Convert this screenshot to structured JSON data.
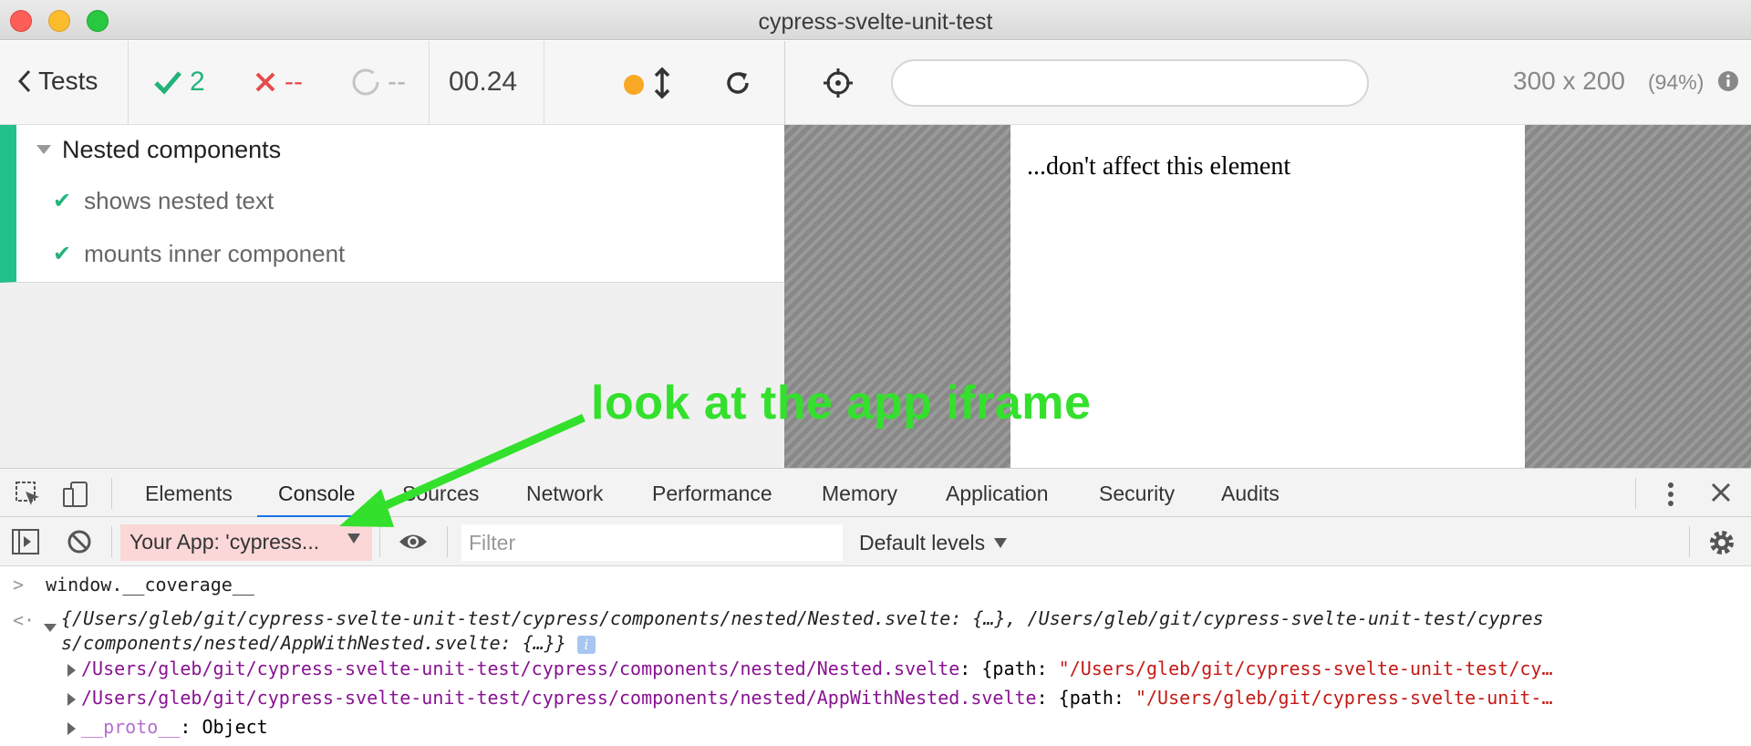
{
  "window": {
    "title": "cypress-svelte-unit-test"
  },
  "runner": {
    "tests_label": "Tests",
    "passed": "2",
    "failed": "--",
    "pending": "--",
    "duration": "00.24",
    "status_dot_color": "#f8a824"
  },
  "app_header": {
    "url": "",
    "viewport_size": "300 x 200",
    "viewport_scale": "(94%)"
  },
  "reporter": {
    "suite_title": "Nested components",
    "tests": [
      {
        "title": "shows nested text",
        "state": "passed"
      },
      {
        "title": "mounts inner component",
        "state": "passed"
      }
    ]
  },
  "app": {
    "text": "...don't affect this element"
  },
  "annotation": {
    "text": "look at the app iframe",
    "color": "#33e02c"
  },
  "devtools": {
    "tabs": [
      "Elements",
      "Console",
      "Sources",
      "Network",
      "Performance",
      "Memory",
      "Application",
      "Security",
      "Audits"
    ],
    "active_tab": "Console",
    "context": "Your App: 'cypress...",
    "filter_placeholder": "Filter",
    "levels": "Default levels"
  },
  "console": {
    "input": "window.__coverage__",
    "result_line1": "{/Users/gleb/git/cypress-svelte-unit-test/cypress/components/nested/Nested.svelte: {…}, /Users/gleb/git/cypress-svelte-unit-test/cypres",
    "result_line2": "s/components/nested/AppWithNested.svelte: {…}}",
    "entry1_key": "/Users/gleb/git/cypress-svelte-unit-test/cypress/components/nested/Nested.svelte",
    "entry1_prefix": ": {path: ",
    "entry1_value": "\"/Users/gleb/git/cypress-svelte-unit-test/cy…",
    "entry2_key": "/Users/gleb/git/cypress-svelte-unit-test/cypress/components/nested/AppWithNested.svelte",
    "entry2_prefix": ": {path: ",
    "entry2_value": "\"/Users/gleb/git/cypress-svelte-unit-…",
    "proto_key": "__proto__",
    "proto_value": ": Object"
  }
}
